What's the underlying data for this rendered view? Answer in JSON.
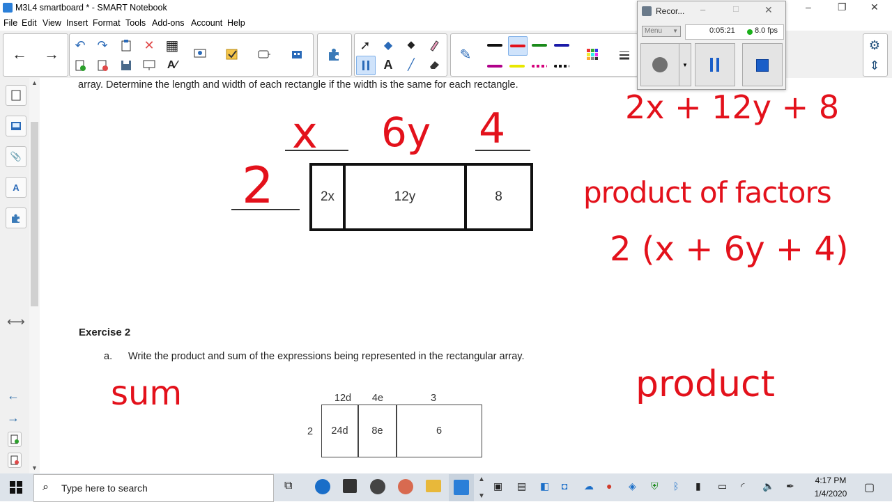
{
  "window": {
    "title": "M3L4 smartboard * - SMART Notebook",
    "minimize": "–",
    "restore": "❐",
    "close": "✕"
  },
  "menu": [
    "File",
    "Edit",
    "View",
    "Insert",
    "Format",
    "Tools",
    "Add-ons",
    "Account",
    "Help"
  ],
  "toolbar": {
    "back": "←",
    "forward": "→",
    "undo": "↶",
    "redo": "↷",
    "delete": "✕",
    "table": "▦",
    "select": "➚",
    "shapes": "◆",
    "fill": "⬥",
    "pen": "✎",
    "eraser": "⌫",
    "text": "A",
    "line": "╱",
    "settings": "⚙",
    "move": "⇕"
  },
  "colors": {
    "ink": "#e3111b",
    "pen_colors": [
      "#111111",
      "#e3111b",
      "#1a8a1a",
      "#1a1aa8",
      "#b0008a",
      "#e8e800",
      "#d4007a",
      "#111111"
    ]
  },
  "recorder": {
    "title": "Recor...",
    "menu_label": "Menu",
    "elapsed": "0:05:21",
    "fps": "8.0 fps"
  },
  "document": {
    "instruction_line": "array.  Determine the length and width of each rectangle if the width is the same for each rectangle.",
    "table1": {
      "cells": [
        "2x",
        "12y",
        "8"
      ]
    },
    "exercise_heading": "Exercise 2",
    "part_letter": "a.",
    "part_text": "Write the product and sum of the expressions being represented in the rectangular array.",
    "table2": {
      "top_labels": [
        "12d",
        "4e",
        "3"
      ],
      "side_label": "2",
      "cells": [
        "24d",
        "8e",
        "6"
      ]
    }
  },
  "ink": {
    "x_label": "x",
    "y_label": "6y",
    "four_label": "4",
    "two_label": "2",
    "expression": "2x + 12y + 8",
    "product_of_factors": "product of factors",
    "factored": "2 (x + 6y + 4)",
    "sum": "sum",
    "product": "product"
  },
  "taskbar": {
    "search_placeholder": "Type here to search",
    "time": "4:17 PM",
    "date": "1/4/2020"
  }
}
